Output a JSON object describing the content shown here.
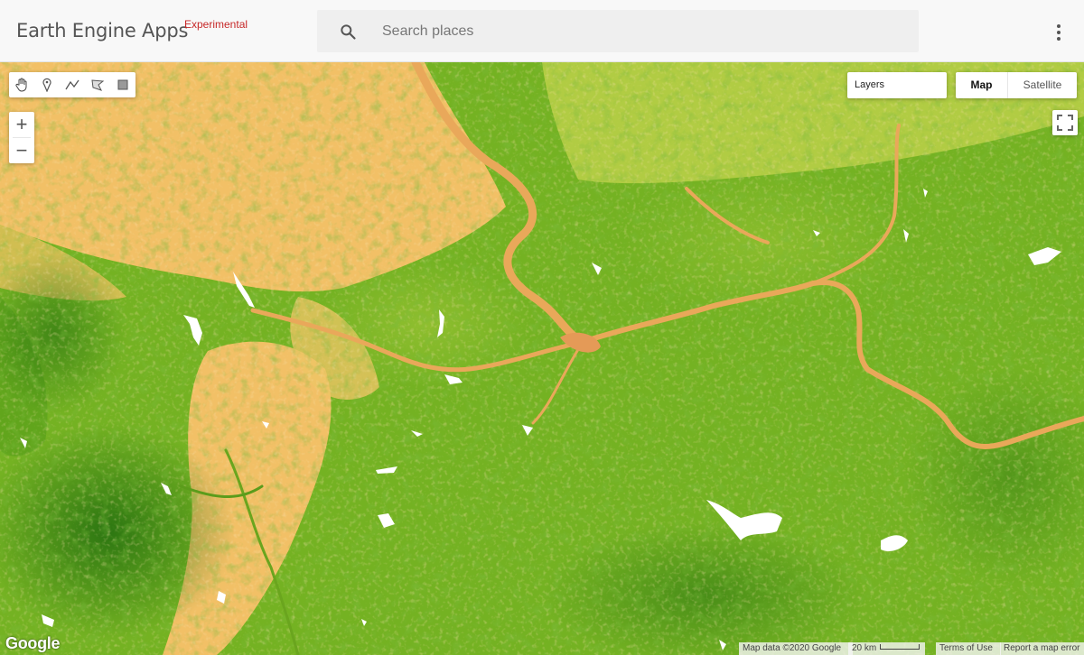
{
  "header": {
    "title": "Earth Engine Apps",
    "badge": "Experimental",
    "search_placeholder": "Search places"
  },
  "map": {
    "layers_label": "Layers",
    "map_type": {
      "map_label": "Map",
      "satellite_label": "Satellite",
      "selected": "Map"
    },
    "zoom": {
      "in_label": "+",
      "out_label": "−"
    },
    "drawing_tools": [
      "hand-icon",
      "marker-icon",
      "line-icon",
      "polygon-icon",
      "rectangle-icon"
    ],
    "logo": "Google",
    "attribution": {
      "map_data": "Map data ©2020 Google",
      "scale": "20 km",
      "terms": "Terms of Use",
      "report": "Report a map error"
    }
  },
  "colors": {
    "dry_soil": "#f2c066",
    "vegetation_light": "#8cbf26",
    "vegetation_mid": "#63a319",
    "vegetation_dark": "#2f7d12",
    "river": "#e4a457",
    "water": "#ffffff",
    "experimental_red": "#c62828"
  }
}
